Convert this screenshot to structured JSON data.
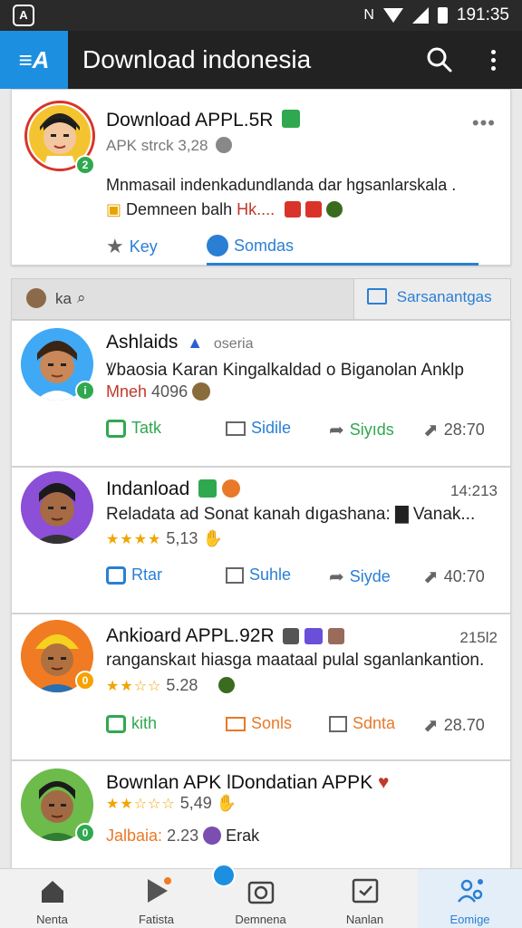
{
  "status": {
    "time": "191:35",
    "left_icon": "app-notification-icon",
    "nfc": "N"
  },
  "appbar": {
    "logo_text": "≡A",
    "title": "Download indonesia"
  },
  "featured": {
    "title": "Download APPL.5R",
    "subtitle": "APK strck  3,28",
    "more": "•••",
    "desc": "Mnmasail indenkadundlanda dar hgsanlarskala .",
    "desc2_prefix": "Demneen balh ",
    "desc2_red": "Hk....",
    "badge_count": "2",
    "link1": "Key",
    "link2": "Somdas"
  },
  "filter": {
    "left": "ka",
    "right": "Sarsanantgas"
  },
  "posts": [
    {
      "title": "Ashlaids",
      "meta": "oseria",
      "time": "",
      "text": "Ꝟbaosia Karan Kingalkaldad o Biganolan Anklp",
      "line3_red": "Mneh",
      "line3_rest": "4096",
      "badge": "i",
      "a1": "Tatk",
      "a2": "Sidile",
      "a3": "Siyıds",
      "a4": "28:70"
    },
    {
      "title": "Indanload",
      "meta": "",
      "time": "14:213",
      "text": "Reladata ad Sonat kanah dıgashana: ▇ Vanak...",
      "stars": "★★★★",
      "line3_rest": "5,13",
      "a1": "Rtar",
      "a2": "Suhle",
      "a3": "Siyde",
      "a4": "40:70"
    },
    {
      "title": "Ankioard APPL.92R",
      "meta": "",
      "time": "215l2",
      "text": "ranganskaıt hiasga maataal pulal sganlankantion.",
      "stars": "★★☆☆",
      "line3_rest": "5.28",
      "badge": "0",
      "a1": "kith",
      "a2": "Sonls",
      "a3": "Sdnta",
      "a4": "28.70"
    },
    {
      "title": "Bownlan APK lDondatian APPK",
      "meta": "",
      "time": "",
      "text": "",
      "stars": "★★☆☆☆",
      "line3_rest": "5,49",
      "line4_red": "Jalbaia:",
      "line4_num": "2.23",
      "line4_name": "Erak",
      "badge": "0"
    }
  ],
  "nav": [
    {
      "label": "Nenta"
    },
    {
      "label": "Fatista"
    },
    {
      "label": "Demnena"
    },
    {
      "label": "Nanlan"
    },
    {
      "label": "Eomige"
    }
  ],
  "colors": {
    "accent": "#2a7fd4",
    "green": "#2fa84f",
    "orange": "#e8792a",
    "appbar": "#222222",
    "logo": "#1d8fe0"
  }
}
